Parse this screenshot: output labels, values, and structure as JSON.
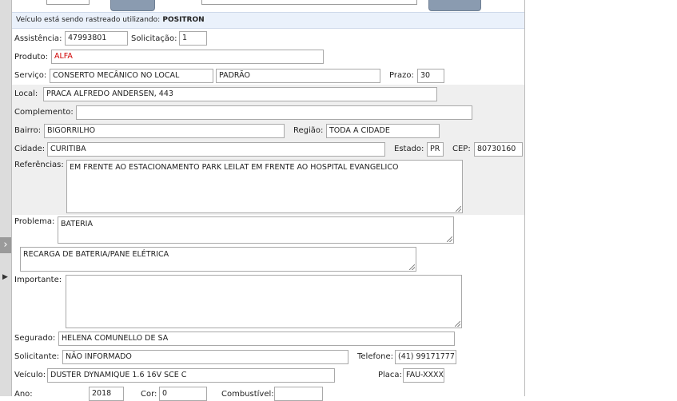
{
  "notice": {
    "prefix": "Veículo está sendo rastreado utilizando:",
    "system": "POSITRON"
  },
  "fields": {
    "assistencia": {
      "label": "Assistência:",
      "value": "47993801"
    },
    "solicitacao": {
      "label": "Solicitação:",
      "value": "1"
    },
    "produto": {
      "label": "Produto:",
      "value": "ALFA"
    },
    "servico": {
      "label": "Serviço:",
      "value": "CONSERTO MECÂNICO NO LOCAL",
      "value2": "PADRÃO"
    },
    "prazo": {
      "label": "Prazo:",
      "value": "30"
    },
    "local": {
      "label": "Local:",
      "value": "PRACA ALFREDO ANDERSEN, 443"
    },
    "complemento": {
      "label": "Complemento:",
      "value": ""
    },
    "bairro": {
      "label": "Bairro:",
      "value": "BIGORRILHO"
    },
    "regiao": {
      "label": "Região:",
      "value": "TODA A CIDADE"
    },
    "cidade": {
      "label": "Cidade:",
      "value": "CURITIBA"
    },
    "estado": {
      "label": "Estado:",
      "value": "PR"
    },
    "cep": {
      "label": "CEP:",
      "value": "80730160"
    },
    "referencias": {
      "label": "Referências:",
      "value": "EM FRENTE AO ESTACIONAMENTO PARK LEILAT EM FRENTE AO HOSPITAL EVANGELICO"
    },
    "problema": {
      "label": "Problema:",
      "value": "BATERIA"
    },
    "problema_detalhe": {
      "value": "RECARGA DE BATERIA/PANE ELÉTRICA"
    },
    "importante": {
      "label": "Importante:",
      "value": ""
    },
    "segurado": {
      "label": "Segurado:",
      "value": "HELENA COMUNELLO DE SA"
    },
    "solicitante": {
      "label": "Solicitante:",
      "value": "NÃO INFORMADO"
    },
    "telefone": {
      "label": "Telefone:",
      "value": "(41) 99171777"
    },
    "veiculo": {
      "label": "Veículo:",
      "value": "DUSTER DYNAMIQUE 1.6 16V SCE C"
    },
    "placa": {
      "label": "Placa:",
      "value": "FAU-XXXX"
    },
    "ano": {
      "label": "Ano:",
      "value": "2018"
    },
    "cor": {
      "label": "Cor:",
      "value": "0"
    },
    "combustivel": {
      "label": "Combustível:",
      "value": ""
    }
  },
  "colors": {
    "produto_value": "#d00000",
    "notice_bg": "#eaf1fb",
    "band_bg": "#efefef"
  },
  "icons": {
    "collapse": "chevron-right-icon",
    "expand": "triangle-right-icon"
  }
}
